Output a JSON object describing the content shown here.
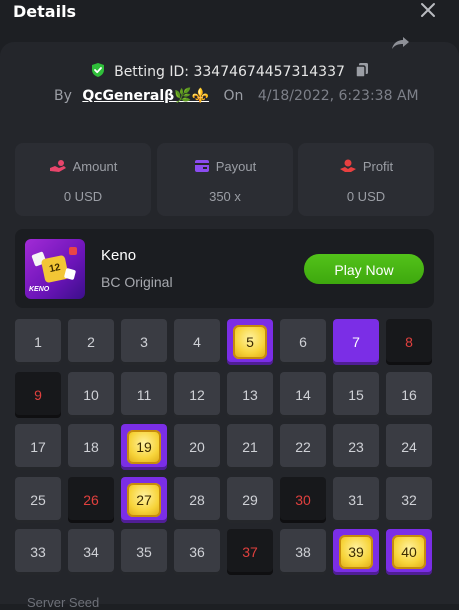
{
  "header": {
    "title": "Details"
  },
  "bet": {
    "id_label": "Betting ID: 33474674457314337",
    "by_label": "By",
    "username": "QcGeneralβ🌿⚜️",
    "on_label": "On",
    "datetime": "4/18/2022, 6:23:38 AM"
  },
  "stats": [
    {
      "label": "Amount",
      "value": "0 USD",
      "color": "#e8456b"
    },
    {
      "label": "Payout",
      "value": "350 x",
      "color": "#8b4cf0"
    },
    {
      "label": "Profit",
      "value": "0 USD",
      "color": "#e84040"
    }
  ],
  "game": {
    "name": "Keno",
    "provider": "BC Original",
    "thumb_text": "KENO",
    "thumb_tile": "12",
    "play_label": "Play Now"
  },
  "board": [
    {
      "n": "1",
      "s": "normal"
    },
    {
      "n": "2",
      "s": "normal"
    },
    {
      "n": "3",
      "s": "normal"
    },
    {
      "n": "4",
      "s": "normal"
    },
    {
      "n": "5",
      "s": "hit"
    },
    {
      "n": "6",
      "s": "normal"
    },
    {
      "n": "7",
      "s": "pick"
    },
    {
      "n": "8",
      "s": "miss"
    },
    {
      "n": "9",
      "s": "miss"
    },
    {
      "n": "10",
      "s": "normal"
    },
    {
      "n": "11",
      "s": "normal"
    },
    {
      "n": "12",
      "s": "normal"
    },
    {
      "n": "13",
      "s": "normal"
    },
    {
      "n": "14",
      "s": "normal"
    },
    {
      "n": "15",
      "s": "normal"
    },
    {
      "n": "16",
      "s": "normal"
    },
    {
      "n": "17",
      "s": "normal"
    },
    {
      "n": "18",
      "s": "normal"
    },
    {
      "n": "19",
      "s": "hit"
    },
    {
      "n": "20",
      "s": "normal"
    },
    {
      "n": "21",
      "s": "normal"
    },
    {
      "n": "22",
      "s": "normal"
    },
    {
      "n": "23",
      "s": "normal"
    },
    {
      "n": "24",
      "s": "normal"
    },
    {
      "n": "25",
      "s": "normal"
    },
    {
      "n": "26",
      "s": "miss"
    },
    {
      "n": "27",
      "s": "hit"
    },
    {
      "n": "28",
      "s": "normal"
    },
    {
      "n": "29",
      "s": "normal"
    },
    {
      "n": "30",
      "s": "miss"
    },
    {
      "n": "31",
      "s": "normal"
    },
    {
      "n": "32",
      "s": "normal"
    },
    {
      "n": "33",
      "s": "normal"
    },
    {
      "n": "34",
      "s": "normal"
    },
    {
      "n": "35",
      "s": "normal"
    },
    {
      "n": "36",
      "s": "normal"
    },
    {
      "n": "37",
      "s": "miss"
    },
    {
      "n": "38",
      "s": "normal"
    },
    {
      "n": "39",
      "s": "hit"
    },
    {
      "n": "40",
      "s": "hit"
    }
  ],
  "footer": {
    "seed_label": "Server Seed"
  },
  "icons": [
    "close-icon",
    "share-icon",
    "shield-check-icon",
    "copy-icon",
    "amount-icon",
    "payout-icon",
    "profit-icon"
  ]
}
